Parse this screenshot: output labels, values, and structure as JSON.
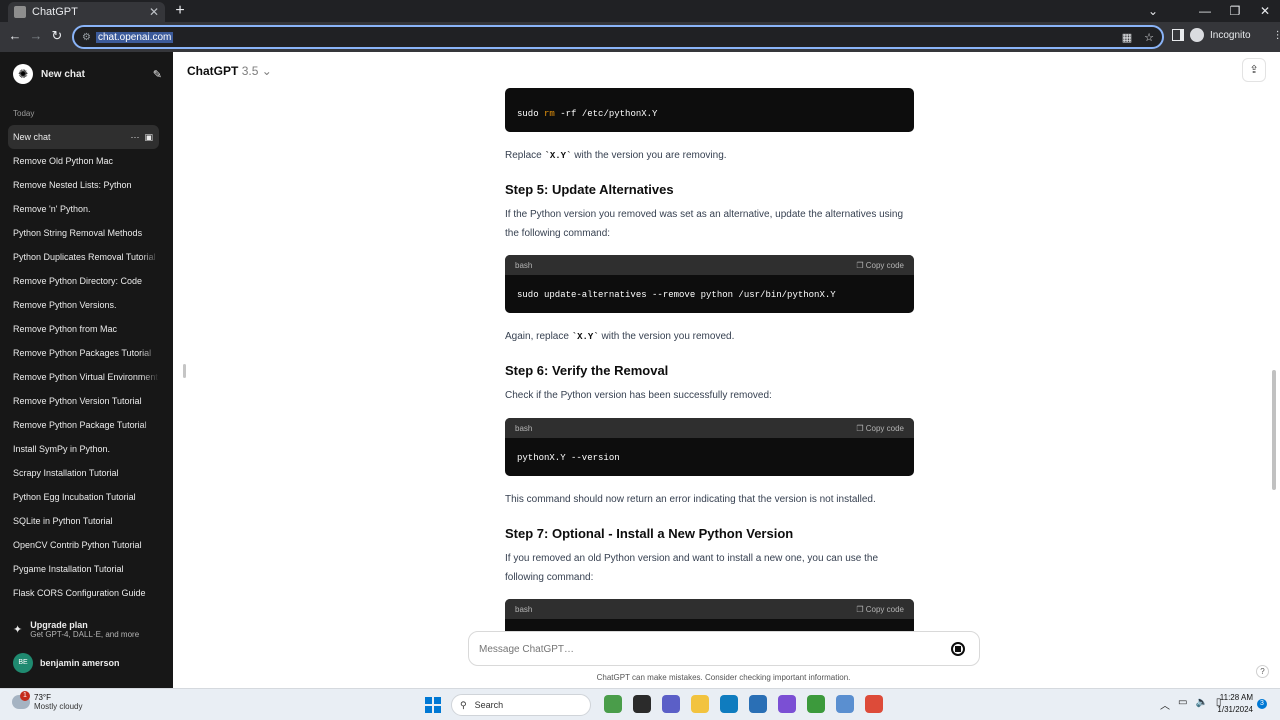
{
  "browser": {
    "tab_title": "ChatGPT",
    "url": "chat.openai.com",
    "incognito_label": "Incognito",
    "icons": [
      "back-icon",
      "forward-icon",
      "reload-icon",
      "tune-icon",
      "qr-icon",
      "star-icon",
      "side-panel-icon",
      "incognito-icon",
      "kebab-icon"
    ]
  },
  "sidebar": {
    "new_chat": "New chat",
    "section": "Today",
    "chats": [
      "New chat",
      "Remove Old Python Mac",
      "Remove Nested Lists: Python",
      "Remove 'n' Python.",
      "Python String Removal Methods",
      "Python Duplicates Removal Tutorial",
      "Remove Python Directory: Code",
      "Remove Python Versions.",
      "Remove Python from Mac",
      "Remove Python Packages Tutorial",
      "Remove Python Virtual Environment",
      "Remove Python Version Tutorial",
      "Remove Python Package Tutorial",
      "Install SymPy in Python.",
      "Scrapy Installation Tutorial",
      "Python Egg Incubation Tutorial",
      "SQLite in Python Tutorial",
      "OpenCV Contrib Python Tutorial",
      "Pygame Installation Tutorial",
      "Flask CORS Configuration Guide"
    ],
    "upgrade_title": "Upgrade plan",
    "upgrade_sub": "Get GPT-4, DALL·E, and more",
    "user_initials": "BE",
    "user_name": "benjamin amerson"
  },
  "header": {
    "model": "ChatGPT",
    "version": "3.5"
  },
  "content": {
    "code1": {
      "cmd": "sudo",
      "kw": "rm",
      "rest": "-rf /etc/pythonX.Y"
    },
    "p1_pre": "Replace ",
    "p1_code": "`X.Y`",
    "p1_post": " with the version you are removing.",
    "h_step5": "Step 5: Update Alternatives",
    "p2": "If the Python version you removed was set as an alternative, update the alternatives using the following command:",
    "code_lang": "bash",
    "copy_label": "Copy code",
    "code2": "sudo update-alternatives --remove python /usr/bin/pythonX.Y",
    "p3_pre": "Again, replace ",
    "p3_code": "`X.Y`",
    "p3_post": " with the version you removed.",
    "h_step6": "Step 6: Verify the Removal",
    "p4": "Check if the Python version has been successfully removed:",
    "code3": "pythonX.Y --version",
    "p5": "This command should now return an error indicating that the version is not installed.",
    "h_step7": "Step 7: Optional - Install a New Python Version",
    "p6": "If you removed an old Python version and want to install a new one, you can use the following command:"
  },
  "composer": {
    "placeholder": "Message ChatGPT…",
    "disclaimer": "ChatGPT can make mistakes. Consider checking important information.",
    "help": "?"
  },
  "taskbar": {
    "weather_badge": "1",
    "temperature": "73°F",
    "condition": "Mostly cloudy",
    "search": "Search",
    "time": "11:28 AM",
    "date": "1/31/2024",
    "notifications": "3",
    "app_colors": [
      "#4a9d4a",
      "#2b2b2b",
      "#5b5fc7",
      "#f2c33f",
      "#0f7cbf",
      "#2a6fb5",
      "#7b4fd4",
      "#3c9a3c",
      "#5a8fd0",
      "#dd4b39"
    ]
  }
}
